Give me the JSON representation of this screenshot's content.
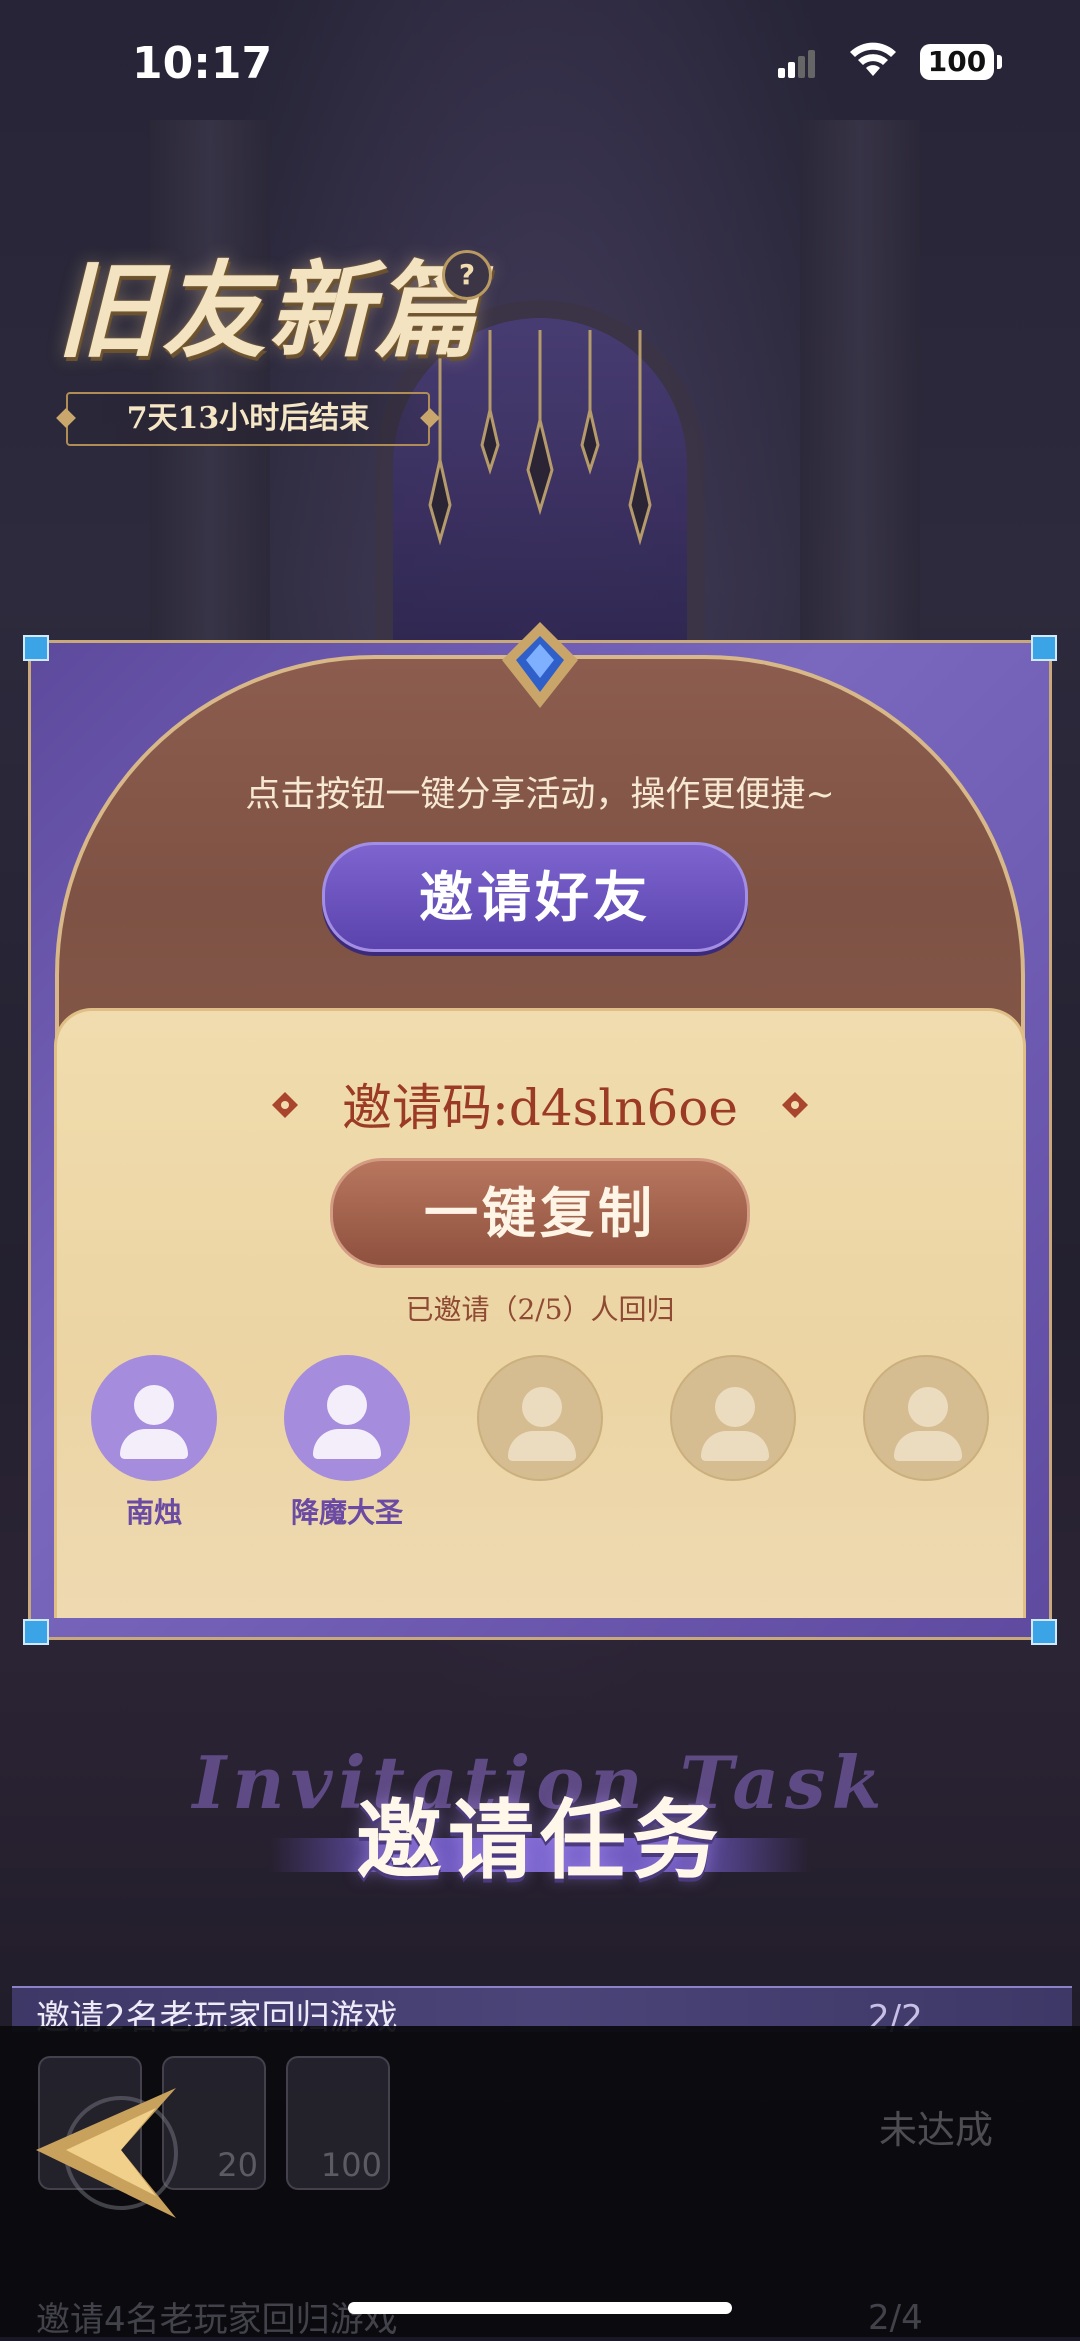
{
  "status_bar": {
    "time": "10:17",
    "battery": "100"
  },
  "event": {
    "title": "旧友新篇",
    "help_label": "?",
    "countdown": "7天13小时后结束"
  },
  "invite_panel": {
    "share_hint": "点击按钮一键分享活动，操作更便捷~",
    "invite_button": "邀请好友",
    "invite_code": "邀请码:d4sln6oe",
    "copy_button": "一键复制",
    "invited_status": "已邀请（2/5）人回归",
    "friends": [
      {
        "name": "南烛",
        "active": true
      },
      {
        "name": "降魔大圣",
        "active": true
      },
      {
        "name": "",
        "active": false
      },
      {
        "name": "",
        "active": false
      },
      {
        "name": "",
        "active": false
      }
    ]
  },
  "tasks": {
    "section_title": "邀请任务",
    "section_title_en": "Invitation Task",
    "items": [
      {
        "label": "邀请2名老玩家回归游戏",
        "progress": "2/2",
        "rewards": [
          "",
          "20",
          "100"
        ],
        "status": "未达成"
      },
      {
        "label": "邀请4名老玩家回归游戏",
        "progress": "2/4"
      }
    ]
  },
  "colors": {
    "accent_purple": "#6a55b8",
    "panel_brown": "#8c5d4f",
    "cream": "#f0dcae",
    "code_red": "#9b3a25"
  },
  "icons": [
    "help-icon",
    "avatar-icon",
    "back-arrow-icon",
    "signal-icon",
    "wifi-icon",
    "battery-icon"
  ]
}
